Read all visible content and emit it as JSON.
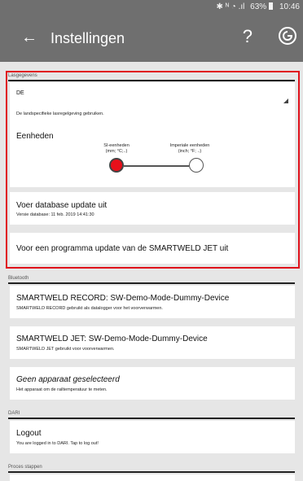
{
  "status_bar": {
    "signal_icons": "✱ ᴺ ◔ .ıl",
    "battery": "63%",
    "time": "10:46"
  },
  "app_bar": {
    "title": "Instellingen",
    "help_label": "?"
  },
  "sections": {
    "lasgegevens": {
      "header": "Lasgegevens",
      "country_value": "DE",
      "country_hint": "De landspecifieke lasregelgeving gebruiken."
    },
    "eenheden": {
      "title": "Eenheden",
      "options": [
        {
          "label": "SI-eenheden",
          "detail": "(mm; °C;..)",
          "selected": true
        },
        {
          "label": "Imperiale eenheden",
          "detail": "(inch; °F; ..)",
          "selected": false
        }
      ]
    },
    "database": {
      "title": "Voer database update uit",
      "subtitle": "Versie database: 11 feb. 2019 14:41:30"
    },
    "program_update": {
      "title": "Voor een programma update van de SMARTWELD JET uit"
    },
    "bluetooth": {
      "header": "Bluetooth",
      "items": [
        {
          "title": "SMARTWELD RECORD: SW-Demo-Mode-Dummy-Device",
          "subtitle": "SMARTWELD RECORD gebruikt als datalogger voor het voorverwarmen."
        },
        {
          "title": "SMARTWELD JET: SW-Demo-Mode-Dummy-Device",
          "subtitle": "SMARTWELD JET gebruikt voor voorverwarmen."
        },
        {
          "title": "Geen apparaat geselecteerd",
          "subtitle": "Het apparaat om de railtemperatuur te meten."
        }
      ]
    },
    "dari": {
      "header": "DARI",
      "title": "Logout",
      "subtitle": "You are logged in to DARI. Tap to log out!"
    },
    "proces": {
      "header": "Proces stappen"
    }
  },
  "colors": {
    "app_bar": "#6f6f6f",
    "highlight_border": "#e0101a",
    "selected_radio": "#e8101a",
    "background": "#e6e6e6"
  }
}
